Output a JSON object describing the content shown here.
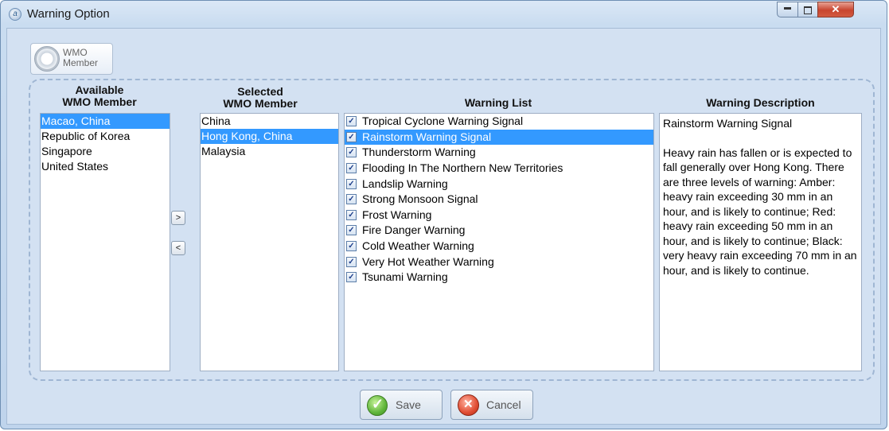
{
  "window": {
    "title": "Warning Option"
  },
  "wmo_badge": {
    "line1": "WMO",
    "line2": "Member"
  },
  "available": {
    "header_line1": "Available",
    "header_line2": "WMO Member",
    "items": [
      "Macao, China",
      "Republic of Korea",
      "Singapore",
      "United States"
    ],
    "selected_index": 0
  },
  "selected": {
    "header_line1": "Selected",
    "header_line2": "WMO Member",
    "items": [
      "China",
      "Hong Kong, China",
      "Malaysia"
    ],
    "selected_index": 1
  },
  "transfer": {
    "add_label": ">",
    "remove_label": "<"
  },
  "warning_list": {
    "header": "Warning List",
    "items": [
      {
        "label": "Tropical Cyclone Warning Signal",
        "checked": true
      },
      {
        "label": "Rainstorm Warning Signal",
        "checked": true
      },
      {
        "label": "Thunderstorm Warning",
        "checked": true
      },
      {
        "label": "Flooding In The Northern New Territories",
        "checked": true
      },
      {
        "label": "Landslip Warning",
        "checked": true
      },
      {
        "label": "Strong Monsoon Signal",
        "checked": true
      },
      {
        "label": "Frost Warning",
        "checked": true
      },
      {
        "label": "Fire Danger Warning",
        "checked": true
      },
      {
        "label": "Cold Weather Warning",
        "checked": true
      },
      {
        "label": "Very Hot Weather Warning",
        "checked": true
      },
      {
        "label": "Tsunami Warning",
        "checked": true
      }
    ],
    "selected_index": 1
  },
  "description": {
    "header": "Warning Description",
    "title": "Rainstorm Warning Signal",
    "body": "Heavy rain has fallen or is expected to fall generally over Hong Kong. There are three levels of warning: Amber: heavy rain exceeding 30 mm in an hour, and is likely to continue; Red: heavy rain exceeding 50 mm in an hour, and is likely to continue; Black: very heavy rain exceeding 70 mm in an hour, and is likely to continue."
  },
  "buttons": {
    "save": "Save",
    "cancel": "Cancel"
  }
}
